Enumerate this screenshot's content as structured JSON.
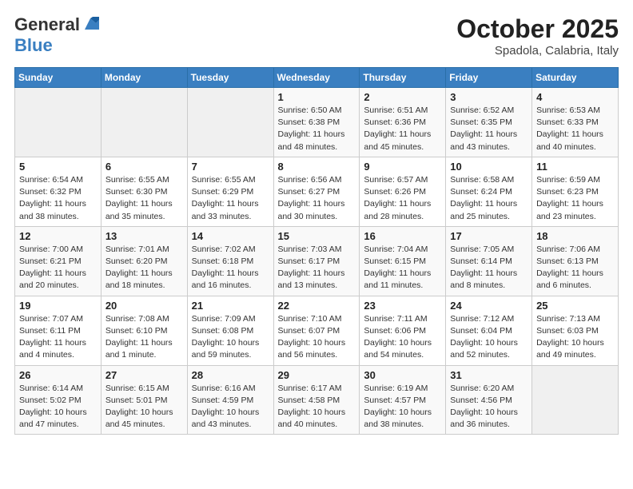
{
  "header": {
    "logo_general": "General",
    "logo_blue": "Blue",
    "month": "October 2025",
    "location": "Spadola, Calabria, Italy"
  },
  "weekdays": [
    "Sunday",
    "Monday",
    "Tuesday",
    "Wednesday",
    "Thursday",
    "Friday",
    "Saturday"
  ],
  "weeks": [
    [
      {
        "day": "",
        "info": ""
      },
      {
        "day": "",
        "info": ""
      },
      {
        "day": "",
        "info": ""
      },
      {
        "day": "1",
        "info": "Sunrise: 6:50 AM\nSunset: 6:38 PM\nDaylight: 11 hours\nand 48 minutes."
      },
      {
        "day": "2",
        "info": "Sunrise: 6:51 AM\nSunset: 6:36 PM\nDaylight: 11 hours\nand 45 minutes."
      },
      {
        "day": "3",
        "info": "Sunrise: 6:52 AM\nSunset: 6:35 PM\nDaylight: 11 hours\nand 43 minutes."
      },
      {
        "day": "4",
        "info": "Sunrise: 6:53 AM\nSunset: 6:33 PM\nDaylight: 11 hours\nand 40 minutes."
      }
    ],
    [
      {
        "day": "5",
        "info": "Sunrise: 6:54 AM\nSunset: 6:32 PM\nDaylight: 11 hours\nand 38 minutes."
      },
      {
        "day": "6",
        "info": "Sunrise: 6:55 AM\nSunset: 6:30 PM\nDaylight: 11 hours\nand 35 minutes."
      },
      {
        "day": "7",
        "info": "Sunrise: 6:55 AM\nSunset: 6:29 PM\nDaylight: 11 hours\nand 33 minutes."
      },
      {
        "day": "8",
        "info": "Sunrise: 6:56 AM\nSunset: 6:27 PM\nDaylight: 11 hours\nand 30 minutes."
      },
      {
        "day": "9",
        "info": "Sunrise: 6:57 AM\nSunset: 6:26 PM\nDaylight: 11 hours\nand 28 minutes."
      },
      {
        "day": "10",
        "info": "Sunrise: 6:58 AM\nSunset: 6:24 PM\nDaylight: 11 hours\nand 25 minutes."
      },
      {
        "day": "11",
        "info": "Sunrise: 6:59 AM\nSunset: 6:23 PM\nDaylight: 11 hours\nand 23 minutes."
      }
    ],
    [
      {
        "day": "12",
        "info": "Sunrise: 7:00 AM\nSunset: 6:21 PM\nDaylight: 11 hours\nand 20 minutes."
      },
      {
        "day": "13",
        "info": "Sunrise: 7:01 AM\nSunset: 6:20 PM\nDaylight: 11 hours\nand 18 minutes."
      },
      {
        "day": "14",
        "info": "Sunrise: 7:02 AM\nSunset: 6:18 PM\nDaylight: 11 hours\nand 16 minutes."
      },
      {
        "day": "15",
        "info": "Sunrise: 7:03 AM\nSunset: 6:17 PM\nDaylight: 11 hours\nand 13 minutes."
      },
      {
        "day": "16",
        "info": "Sunrise: 7:04 AM\nSunset: 6:15 PM\nDaylight: 11 hours\nand 11 minutes."
      },
      {
        "day": "17",
        "info": "Sunrise: 7:05 AM\nSunset: 6:14 PM\nDaylight: 11 hours\nand 8 minutes."
      },
      {
        "day": "18",
        "info": "Sunrise: 7:06 AM\nSunset: 6:13 PM\nDaylight: 11 hours\nand 6 minutes."
      }
    ],
    [
      {
        "day": "19",
        "info": "Sunrise: 7:07 AM\nSunset: 6:11 PM\nDaylight: 11 hours\nand 4 minutes."
      },
      {
        "day": "20",
        "info": "Sunrise: 7:08 AM\nSunset: 6:10 PM\nDaylight: 11 hours\nand 1 minute."
      },
      {
        "day": "21",
        "info": "Sunrise: 7:09 AM\nSunset: 6:08 PM\nDaylight: 10 hours\nand 59 minutes."
      },
      {
        "day": "22",
        "info": "Sunrise: 7:10 AM\nSunset: 6:07 PM\nDaylight: 10 hours\nand 56 minutes."
      },
      {
        "day": "23",
        "info": "Sunrise: 7:11 AM\nSunset: 6:06 PM\nDaylight: 10 hours\nand 54 minutes."
      },
      {
        "day": "24",
        "info": "Sunrise: 7:12 AM\nSunset: 6:04 PM\nDaylight: 10 hours\nand 52 minutes."
      },
      {
        "day": "25",
        "info": "Sunrise: 7:13 AM\nSunset: 6:03 PM\nDaylight: 10 hours\nand 49 minutes."
      }
    ],
    [
      {
        "day": "26",
        "info": "Sunrise: 6:14 AM\nSunset: 5:02 PM\nDaylight: 10 hours\nand 47 minutes."
      },
      {
        "day": "27",
        "info": "Sunrise: 6:15 AM\nSunset: 5:01 PM\nDaylight: 10 hours\nand 45 minutes."
      },
      {
        "day": "28",
        "info": "Sunrise: 6:16 AM\nSunset: 4:59 PM\nDaylight: 10 hours\nand 43 minutes."
      },
      {
        "day": "29",
        "info": "Sunrise: 6:17 AM\nSunset: 4:58 PM\nDaylight: 10 hours\nand 40 minutes."
      },
      {
        "day": "30",
        "info": "Sunrise: 6:19 AM\nSunset: 4:57 PM\nDaylight: 10 hours\nand 38 minutes."
      },
      {
        "day": "31",
        "info": "Sunrise: 6:20 AM\nSunset: 4:56 PM\nDaylight: 10 hours\nand 36 minutes."
      },
      {
        "day": "",
        "info": ""
      }
    ]
  ]
}
